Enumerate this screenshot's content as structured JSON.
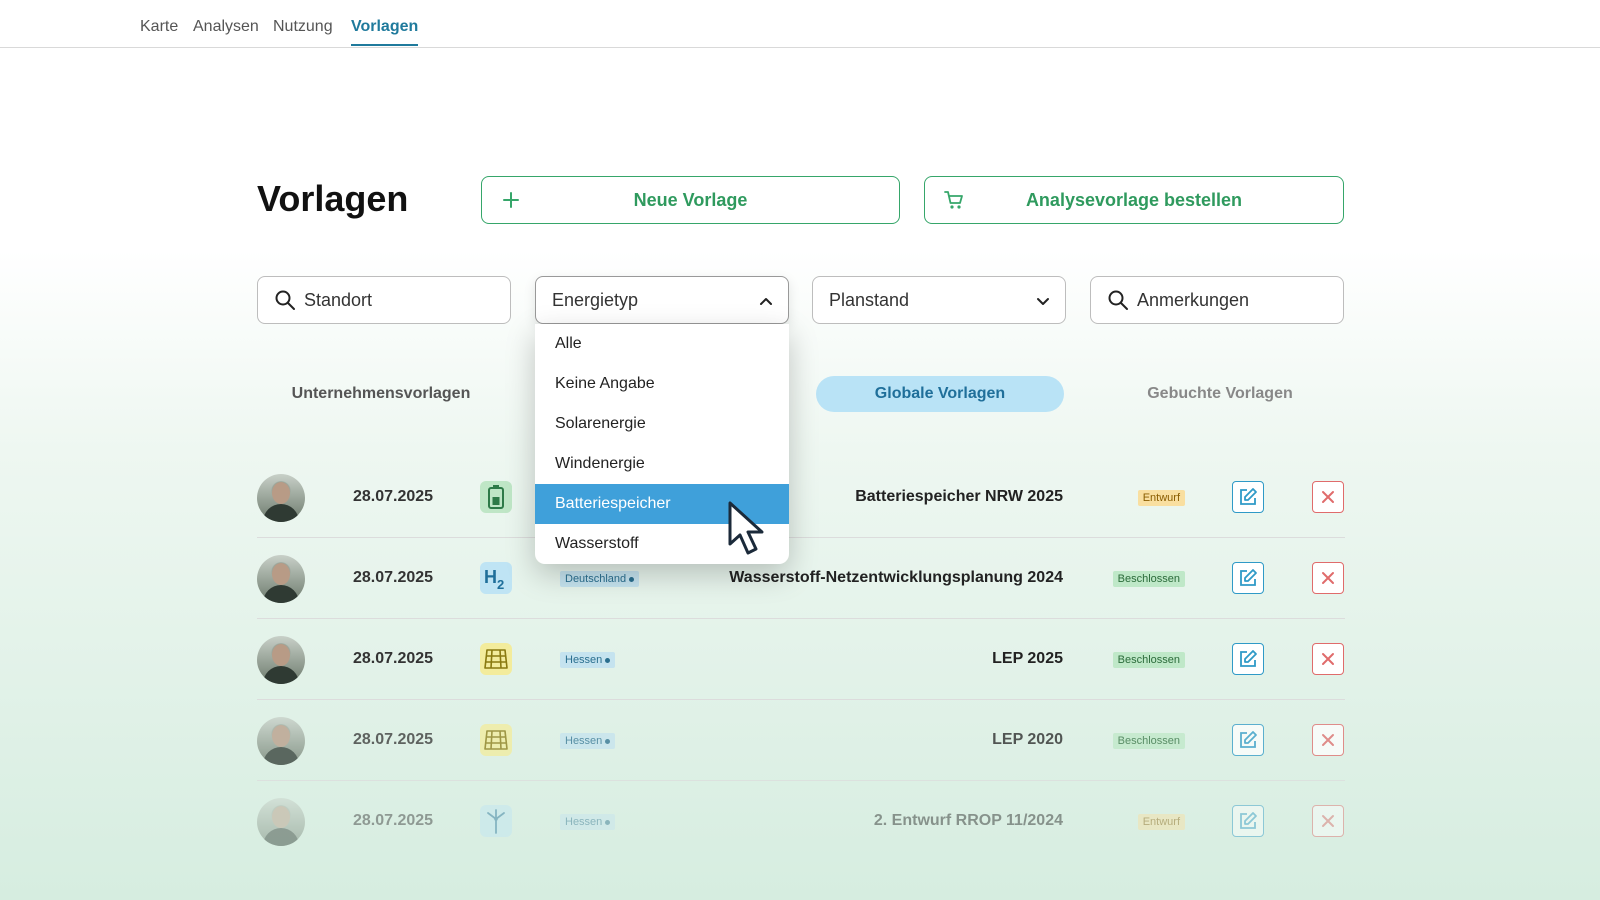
{
  "nav": {
    "tabs": [
      {
        "label": "Karte"
      },
      {
        "label": "Analysen"
      },
      {
        "label": "Nutzung"
      },
      {
        "label": "Vorlagen"
      }
    ],
    "active": "Vorlagen"
  },
  "header": {
    "title": "Vorlagen",
    "new_template_label": "Neue Vorlage",
    "order_template_label": "Analysevorlage bestellen"
  },
  "filters": {
    "location_placeholder": "Standort",
    "energy_type_label": "Energietyp",
    "plan_status_label": "Planstand",
    "notes_placeholder": "Anmerkungen"
  },
  "energy_dropdown": {
    "options": [
      "Alle",
      "Keine Angabe",
      "Solarenergie",
      "Windenergie",
      "Batteriespeicher",
      "Wasserstoff"
    ],
    "selected": "Batteriespeicher"
  },
  "categories": {
    "company": "Unternehmensvorlagen",
    "global": "Globale Vorlagen",
    "booked": "Gebuchte Vorlagen",
    "active": "Globale Vorlagen"
  },
  "rows": [
    {
      "date": "28.07.2025",
      "energy_icon": "battery-icon",
      "region": "",
      "name": "Batteriespeicher NRW 2025",
      "status": "Entwurf",
      "status_kind": "draft"
    },
    {
      "date": "28.07.2025",
      "energy_icon": "hydrogen-icon",
      "region": "Deutschland",
      "name": "Wasserstoff-Netzentwicklungsplanung 2024",
      "status": "Beschlossen",
      "status_kind": "done"
    },
    {
      "date": "28.07.2025",
      "energy_icon": "solar-panel-icon",
      "region": "Hessen",
      "name": "LEP 2025",
      "status": "Beschlossen",
      "status_kind": "done"
    },
    {
      "date": "28.07.2025",
      "energy_icon": "solar-panel-icon",
      "region": "Hessen",
      "name": "LEP 2020",
      "status": "Beschlossen",
      "status_kind": "done"
    },
    {
      "date": "28.07.2025",
      "energy_icon": "wind-turbine-icon",
      "region": "Hessen",
      "name": "2. Entwurf RROP 11/2024",
      "status": "Entwurf",
      "status_kind": "draft"
    }
  ],
  "colors": {
    "accent_green": "#36a66a",
    "accent_blue": "#1f7a9c",
    "selected_option": "#3fa0da",
    "delete_red": "#e06b6b"
  }
}
